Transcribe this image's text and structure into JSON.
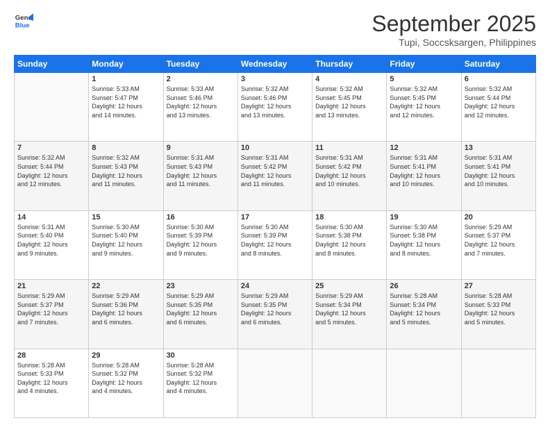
{
  "logo": {
    "line1": "General",
    "line2": "Blue"
  },
  "title": "September 2025",
  "subtitle": "Tupi, Soccsksargen, Philippines",
  "days_header": [
    "Sunday",
    "Monday",
    "Tuesday",
    "Wednesday",
    "Thursday",
    "Friday",
    "Saturday"
  ],
  "weeks": [
    [
      {
        "day": "",
        "info": ""
      },
      {
        "day": "1",
        "info": "Sunrise: 5:33 AM\nSunset: 5:47 PM\nDaylight: 12 hours\nand 14 minutes."
      },
      {
        "day": "2",
        "info": "Sunrise: 5:33 AM\nSunset: 5:46 PM\nDaylight: 12 hours\nand 13 minutes."
      },
      {
        "day": "3",
        "info": "Sunrise: 5:32 AM\nSunset: 5:46 PM\nDaylight: 12 hours\nand 13 minutes."
      },
      {
        "day": "4",
        "info": "Sunrise: 5:32 AM\nSunset: 5:45 PM\nDaylight: 12 hours\nand 13 minutes."
      },
      {
        "day": "5",
        "info": "Sunrise: 5:32 AM\nSunset: 5:45 PM\nDaylight: 12 hours\nand 12 minutes."
      },
      {
        "day": "6",
        "info": "Sunrise: 5:32 AM\nSunset: 5:44 PM\nDaylight: 12 hours\nand 12 minutes."
      }
    ],
    [
      {
        "day": "7",
        "info": "Sunrise: 5:32 AM\nSunset: 5:44 PM\nDaylight: 12 hours\nand 12 minutes."
      },
      {
        "day": "8",
        "info": "Sunrise: 5:32 AM\nSunset: 5:43 PM\nDaylight: 12 hours\nand 11 minutes."
      },
      {
        "day": "9",
        "info": "Sunrise: 5:31 AM\nSunset: 5:43 PM\nDaylight: 12 hours\nand 11 minutes."
      },
      {
        "day": "10",
        "info": "Sunrise: 5:31 AM\nSunset: 5:42 PM\nDaylight: 12 hours\nand 11 minutes."
      },
      {
        "day": "11",
        "info": "Sunrise: 5:31 AM\nSunset: 5:42 PM\nDaylight: 12 hours\nand 10 minutes."
      },
      {
        "day": "12",
        "info": "Sunrise: 5:31 AM\nSunset: 5:41 PM\nDaylight: 12 hours\nand 10 minutes."
      },
      {
        "day": "13",
        "info": "Sunrise: 5:31 AM\nSunset: 5:41 PM\nDaylight: 12 hours\nand 10 minutes."
      }
    ],
    [
      {
        "day": "14",
        "info": "Sunrise: 5:31 AM\nSunset: 5:40 PM\nDaylight: 12 hours\nand 9 minutes."
      },
      {
        "day": "15",
        "info": "Sunrise: 5:30 AM\nSunset: 5:40 PM\nDaylight: 12 hours\nand 9 minutes."
      },
      {
        "day": "16",
        "info": "Sunrise: 5:30 AM\nSunset: 5:39 PM\nDaylight: 12 hours\nand 9 minutes."
      },
      {
        "day": "17",
        "info": "Sunrise: 5:30 AM\nSunset: 5:39 PM\nDaylight: 12 hours\nand 8 minutes."
      },
      {
        "day": "18",
        "info": "Sunrise: 5:30 AM\nSunset: 5:38 PM\nDaylight: 12 hours\nand 8 minutes."
      },
      {
        "day": "19",
        "info": "Sunrise: 5:30 AM\nSunset: 5:38 PM\nDaylight: 12 hours\nand 8 minutes."
      },
      {
        "day": "20",
        "info": "Sunrise: 5:29 AM\nSunset: 5:37 PM\nDaylight: 12 hours\nand 7 minutes."
      }
    ],
    [
      {
        "day": "21",
        "info": "Sunrise: 5:29 AM\nSunset: 5:37 PM\nDaylight: 12 hours\nand 7 minutes."
      },
      {
        "day": "22",
        "info": "Sunrise: 5:29 AM\nSunset: 5:36 PM\nDaylight: 12 hours\nand 6 minutes."
      },
      {
        "day": "23",
        "info": "Sunrise: 5:29 AM\nSunset: 5:35 PM\nDaylight: 12 hours\nand 6 minutes."
      },
      {
        "day": "24",
        "info": "Sunrise: 5:29 AM\nSunset: 5:35 PM\nDaylight: 12 hours\nand 6 minutes."
      },
      {
        "day": "25",
        "info": "Sunrise: 5:29 AM\nSunset: 5:34 PM\nDaylight: 12 hours\nand 5 minutes."
      },
      {
        "day": "26",
        "info": "Sunrise: 5:28 AM\nSunset: 5:34 PM\nDaylight: 12 hours\nand 5 minutes."
      },
      {
        "day": "27",
        "info": "Sunrise: 5:28 AM\nSunset: 5:33 PM\nDaylight: 12 hours\nand 5 minutes."
      }
    ],
    [
      {
        "day": "28",
        "info": "Sunrise: 5:28 AM\nSunset: 5:33 PM\nDaylight: 12 hours\nand 4 minutes."
      },
      {
        "day": "29",
        "info": "Sunrise: 5:28 AM\nSunset: 5:32 PM\nDaylight: 12 hours\nand 4 minutes."
      },
      {
        "day": "30",
        "info": "Sunrise: 5:28 AM\nSunset: 5:32 PM\nDaylight: 12 hours\nand 4 minutes."
      },
      {
        "day": "",
        "info": ""
      },
      {
        "day": "",
        "info": ""
      },
      {
        "day": "",
        "info": ""
      },
      {
        "day": "",
        "info": ""
      }
    ]
  ]
}
